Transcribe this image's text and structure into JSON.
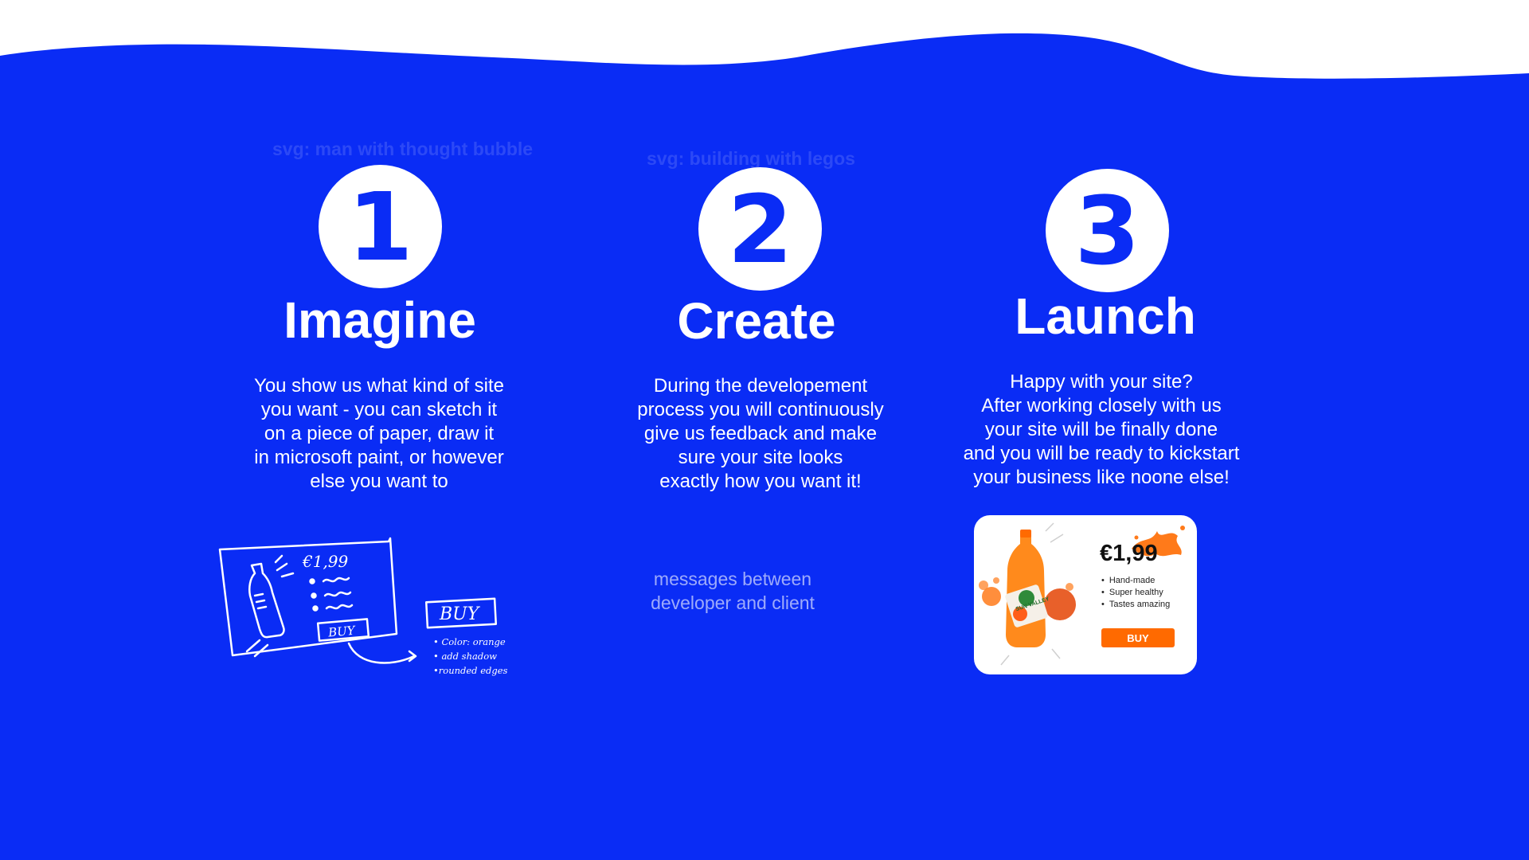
{
  "colors": {
    "background": "#0a2cf5",
    "text": "#ffffff",
    "accent_button": "#ff6a00"
  },
  "steps": [
    {
      "placeholder": "svg: man with thought bubble",
      "number": "1",
      "title": "Imagine",
      "lines": [
        "You show us what kind of site",
        "you want - you can sketch it",
        "on a piece of paper, draw it",
        "in microsoft paint, or however",
        "else you want to"
      ]
    },
    {
      "placeholder": "svg: building with legos",
      "number": "2",
      "title": "Create",
      "lines": [
        "During the developement",
        "process you will continuously",
        "give us feedback and make",
        "sure your site looks",
        "exactly how you want it!"
      ]
    },
    {
      "number": "3",
      "title": "Launch",
      "lines": [
        "Happy with your site?",
        "After working closely with us",
        "your site will be finally done",
        "and you will be ready to kickstart",
        "your business like noone else!"
      ]
    }
  ],
  "sketch": {
    "price": "€1,99",
    "buy_label": "BUY",
    "buy_label_big": "BUY",
    "notes": [
      "• Color: orange",
      "• add shadow",
      "•rounded edges"
    ]
  },
  "messages_placeholder": [
    "messages between",
    "developer and client"
  ],
  "product_card": {
    "price": "€1,99",
    "features": [
      "Hand-made",
      "Super healthy",
      "Tastes amazing"
    ],
    "buy_label": "BUY",
    "bottle_label": "SUN VALLEY"
  }
}
